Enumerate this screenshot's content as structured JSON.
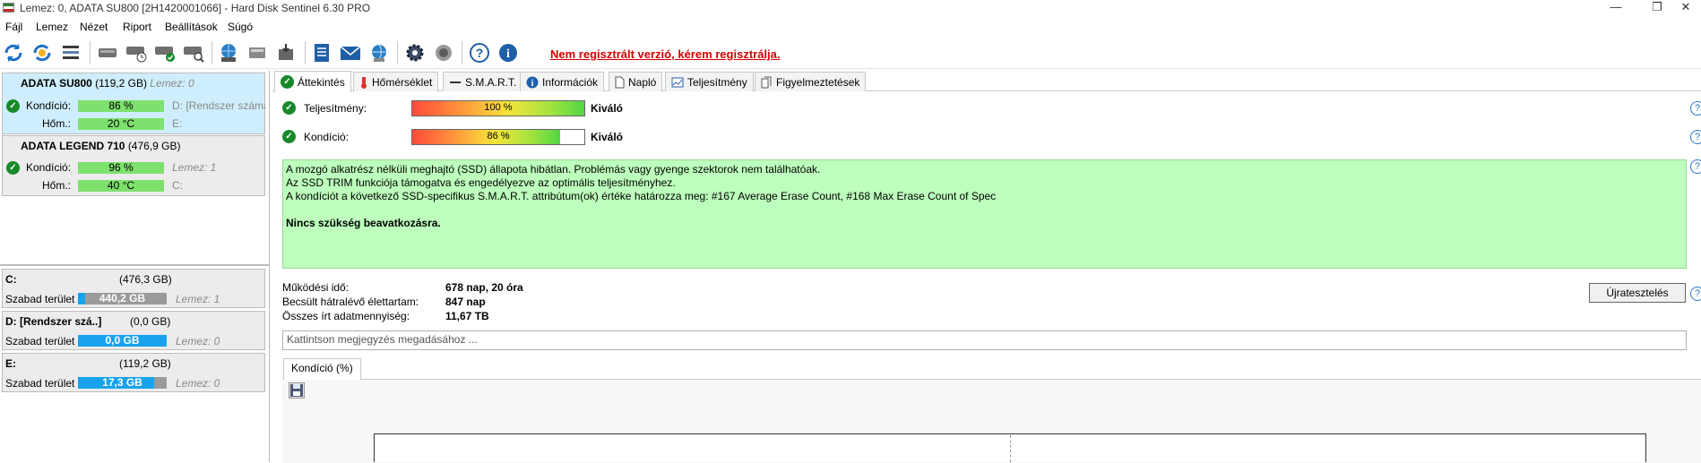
{
  "window": {
    "title": "Lemez: 0, ADATA SU800 [2H1420001066]  -  Hard Disk Sentinel 6.30 PRO",
    "controls": [
      "—",
      "❐",
      "✕"
    ]
  },
  "menu": [
    "Fájl",
    "Lemez",
    "Nézet",
    "Riport",
    "Beállítások",
    "Súgó"
  ],
  "toolbar": {
    "register_link": "Nem regisztrált verzió, kérem regisztrálja."
  },
  "disks": [
    {
      "name": "ADATA SU800",
      "size": "(119,2 GB)",
      "lemez": "Lemez: 0",
      "kondicio_label": "Kondíció:",
      "kondicio": "86 %",
      "kondicio_side": "D: [Rendszer számára fenntartott]",
      "hom_label": "Hőm.:",
      "hom": "20 °C",
      "hom_side": "E:"
    },
    {
      "name": "ADATA LEGEND 710",
      "size": "(476,9 GB)",
      "lemez": "",
      "kondicio_label": "Kondíció:",
      "kondicio": "96 %",
      "kondicio_side": "Lemez: 1",
      "hom_label": "Hőm.:",
      "hom": "40 °C",
      "hom_side": "C:"
    }
  ],
  "volumes": [
    {
      "name": "C:",
      "size": "(476,3 GB)",
      "free_label": "Szabad terület",
      "free": "440,2 GB",
      "lemez": "Lemez: 1",
      "fill": 0.08
    },
    {
      "name": "D: [Rendszer szá..]",
      "size": "(0,0 GB)",
      "free_label": "Szabad terület",
      "free": "0,0 GB",
      "lemez": "Lemez: 0",
      "fill": 1.0
    },
    {
      "name": "E:",
      "size": "(119,2 GB)",
      "free_label": "Szabad terület",
      "free": "17,3 GB",
      "lemez": "Lemez: 0",
      "fill": 0.86
    }
  ],
  "tabs": [
    "Áttekintés",
    "Hőmérséklet",
    "S.M.A.R.T.",
    "Információk",
    "Napló",
    "Teljesítmény",
    "Figyelmeztetések"
  ],
  "overview": {
    "perf_label": "Teljesítmény:",
    "perf_value": "100 %",
    "perf_fill": 1.0,
    "perf_rating": "Kiváló",
    "cond_label": "Kondíció:",
    "cond_value": "86 %",
    "cond_fill": 0.86,
    "cond_rating": "Kiváló",
    "info_lines": [
      "A mozgó alkatrész nélküli meghajtó (SSD) állapota hibátlan. Problémás vagy gyenge szektorok nem találhatóak.",
      "Az SSD TRIM funkciója támogatva és engedélyezve az optimális teljesítményhez.",
      "A kondíciót a következő SSD-specifikus S.M.A.R.T. attribútum(ok) értéke határozza meg:  #167 Average Erase Count, #168 Max Erase Count of Spec"
    ],
    "info_bold": "Nincs szükség beavatkozásra.",
    "uptime_label": "Működési idő:",
    "uptime": "678 nap, 20 óra",
    "remaining_label": "Becsült hátralévő élettartam:",
    "remaining": "847 nap",
    "written_label": "Összes írt adatmennyiség:",
    "written": "11,67 TB",
    "retest_button": "Újratesztelés",
    "note_placeholder": "Kattintson megjegyzés megadásához ...",
    "chart_tab": "Kondíció  (%)"
  },
  "colors": {
    "accent_green": "#bdffbc",
    "ok_green": "#17892a",
    "link_red": "#d40000",
    "bar_blue": "#18a3ec"
  }
}
